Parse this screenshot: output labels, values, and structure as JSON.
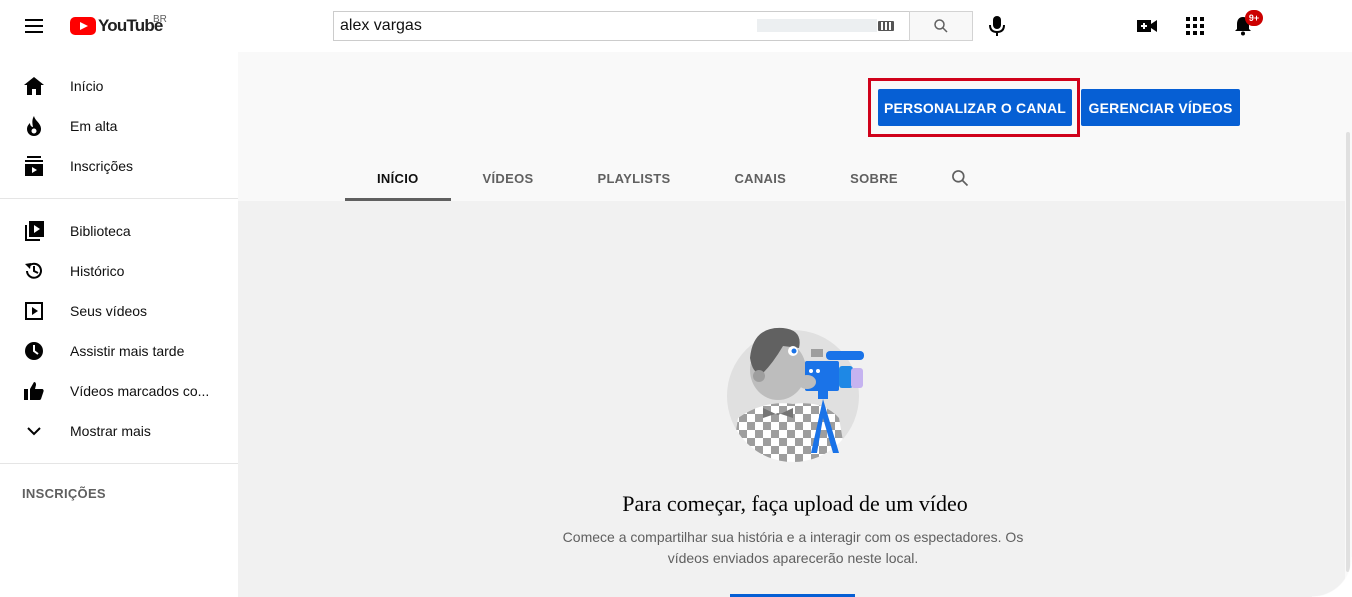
{
  "header": {
    "logo_text": "YouTube",
    "country_code": "BR",
    "search_value": "alex vargas",
    "notifications_badge": "9+"
  },
  "sidebar": {
    "items": [
      {
        "label": "Início",
        "icon": "home-icon"
      },
      {
        "label": "Em alta",
        "icon": "trending-icon"
      },
      {
        "label": "Inscrições",
        "icon": "subscriptions-icon"
      }
    ],
    "library_items": [
      {
        "label": "Biblioteca",
        "icon": "library-icon"
      },
      {
        "label": "Histórico",
        "icon": "history-icon"
      },
      {
        "label": "Seus vídeos",
        "icon": "your-videos-icon"
      },
      {
        "label": "Assistir mais tarde",
        "icon": "watch-later-icon"
      },
      {
        "label": "Vídeos marcados co...",
        "icon": "liked-icon"
      },
      {
        "label": "Mostrar mais",
        "icon": "chevron-down-icon"
      }
    ],
    "subscriptions_heading": "INSCRIÇÕES"
  },
  "channel": {
    "customize_button": "PERSONALIZAR O CANAL",
    "manage_button": "GERENCIAR VÍDEOS",
    "tabs": [
      "INÍCIO",
      "VÍDEOS",
      "PLAYLISTS",
      "CANAIS",
      "SOBRE"
    ],
    "active_tab": "INÍCIO"
  },
  "empty_state": {
    "title": "Para começar, faça upload de um vídeo",
    "description": "Comece a compartilhar sua história e a interagir com os espectadores. Os vídeos enviados aparecerão neste local."
  },
  "colors": {
    "brand_red": "#ff0000",
    "primary_blue": "#065fd4",
    "highlight_red": "#d0021b"
  }
}
